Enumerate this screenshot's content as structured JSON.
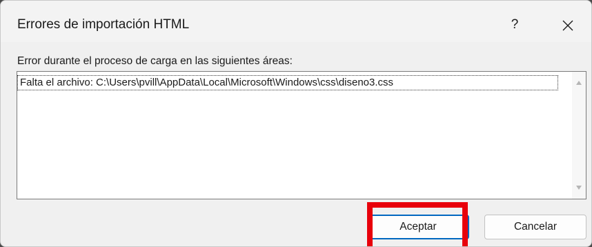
{
  "dialog": {
    "title": "Errores de importación HTML",
    "help_label": "?",
    "message": "Error durante el proceso de carga en las siguientes áreas:",
    "items": [
      "Falta el archivo: C:\\Users\\pvill\\AppData\\Local\\Microsoft\\Windows\\css\\diseno3.css"
    ],
    "ok_label": "Aceptar",
    "cancel_label": "Cancelar"
  },
  "icons": {
    "close": "close-icon",
    "scroll_up": "scroll-up-arrow-icon",
    "scroll_down": "scroll-down-arrow-icon"
  },
  "colors": {
    "accent": "#0067c0",
    "highlight": "#e8000b"
  }
}
